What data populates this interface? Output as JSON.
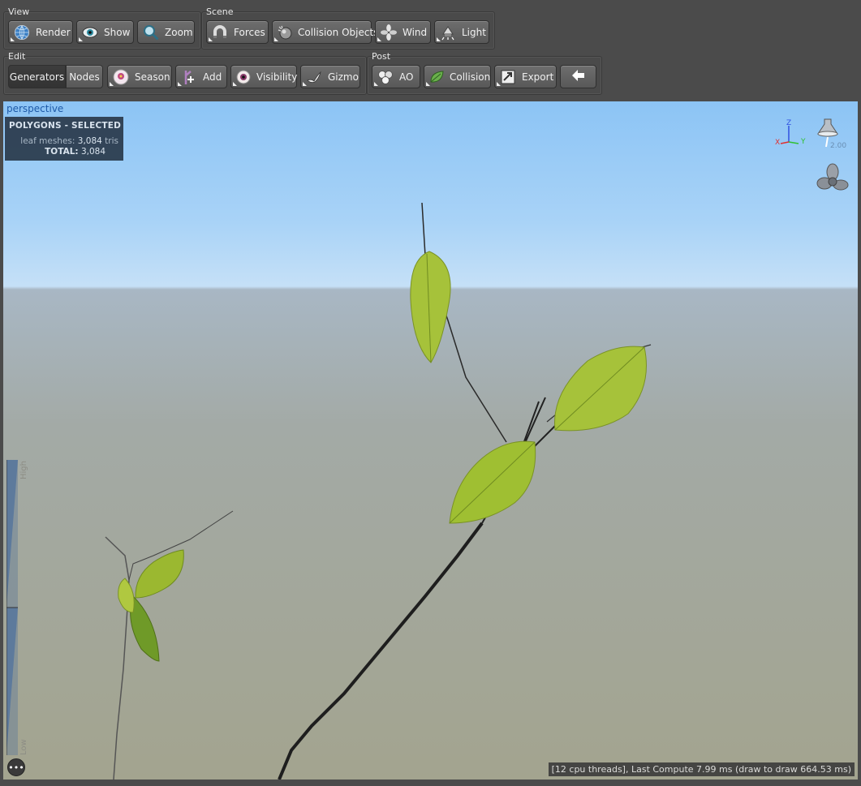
{
  "toolbar": {
    "view": {
      "title": "View",
      "render": "Render",
      "show": "Show",
      "zoom": "Zoom"
    },
    "scene": {
      "title": "Scene",
      "forces": "Forces",
      "collision_objects": "Collision Objects",
      "wind": "Wind",
      "light": "Light"
    },
    "edit": {
      "title": "Edit",
      "generators": "Generators",
      "nodes": "Nodes",
      "season": "Season",
      "add": "Add",
      "visibility": "Visibility",
      "gizmo": "Gizmo"
    },
    "post": {
      "title": "Post",
      "ao": "AO",
      "collision": "Collision",
      "export": "Export"
    }
  },
  "viewport": {
    "camera_label": "perspective",
    "polygons": {
      "title": "POLYGONS - SELECTED",
      "leaf_label": "leaf meshes:",
      "leaf_value": "3,084",
      "leaf_unit": "tris",
      "total_label": "TOTAL:",
      "total_value": "3,084"
    },
    "axes": {
      "z": "Z",
      "x": "X",
      "y": "Y"
    },
    "light_value": "2.00",
    "lod": {
      "high": "High",
      "low": "Low"
    },
    "more_label": "•••",
    "status": "[12 cpu threads], Last Compute 7.99 ms (draw to draw 664.53 ms)"
  },
  "colors": {
    "sky_top": "#8cc4f5",
    "ground": "#a3a48f",
    "leaf": "#a6c23a",
    "axis_x": "#e03030",
    "axis_y": "#30c030",
    "axis_z": "#3050e0",
    "camera_label": "#1e5aa8"
  }
}
